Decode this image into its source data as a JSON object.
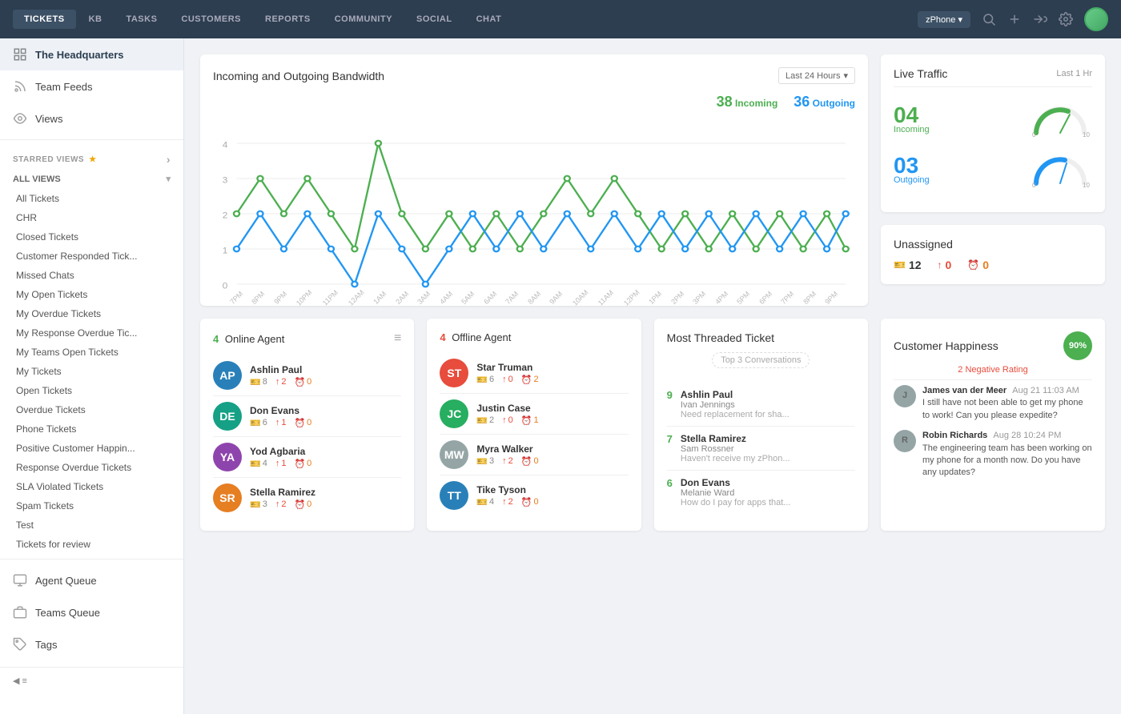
{
  "nav": {
    "tabs": [
      {
        "label": "TICKETS",
        "active": true
      },
      {
        "label": "KB",
        "active": false
      },
      {
        "label": "TASKS",
        "active": false
      },
      {
        "label": "CUSTOMERS",
        "active": false
      },
      {
        "label": "REPORTS",
        "active": false
      },
      {
        "label": "COMMUNITY",
        "active": false
      },
      {
        "label": "SOCIAL",
        "active": false
      },
      {
        "label": "CHAT",
        "active": false
      }
    ],
    "phone": "zPhone",
    "phone_arrow": "▾"
  },
  "sidebar": {
    "headquarters": "The Headquarters",
    "team_feeds": "Team Feeds",
    "views": "Views",
    "starred_label": "STARRED VIEWS",
    "all_views_label": "ALL VIEWS",
    "view_items": [
      "All Tickets",
      "CHR",
      "Closed Tickets",
      "Customer Responded Tick...",
      "Missed Chats",
      "My Open Tickets",
      "My Overdue Tickets",
      "My Response Overdue Tic...",
      "My Teams Open Tickets",
      "My Tickets",
      "Open Tickets",
      "Overdue Tickets",
      "Phone Tickets",
      "Positive Customer Happin...",
      "Response Overdue Tickets",
      "SLA Violated Tickets",
      "Spam Tickets",
      "Test",
      "Tickets for review"
    ],
    "agent_queue": "Agent Queue",
    "teams_queue": "Teams Queue",
    "tags": "Tags"
  },
  "bandwidth": {
    "title": "Incoming and Outgoing Bandwidth",
    "time_filter": "Last 24 Hours",
    "incoming_count": "38",
    "incoming_label": "Incoming",
    "outgoing_count": "36",
    "outgoing_label": "Outgoing",
    "y_labels": [
      "0",
      "1",
      "2",
      "3",
      "4"
    ],
    "x_labels": [
      "7PM",
      "8PM",
      "9PM",
      "10PM",
      "11PM",
      "12AM",
      "1AM",
      "2AM",
      "3AM",
      "4AM",
      "5AM",
      "6AM",
      "7AM",
      "8AM",
      "9AM",
      "10AM",
      "11AM",
      "12PM",
      "1PM",
      "2PM",
      "3PM",
      "4PM",
      "5PM",
      "6PM",
      "7PM",
      "8PM",
      "9PM"
    ]
  },
  "live_traffic": {
    "title": "Live Traffic",
    "time": "Last 1 Hr",
    "incoming_num": "04",
    "incoming_label": "Incoming",
    "outgoing_num": "03",
    "outgoing_label": "Outgoing"
  },
  "unassigned": {
    "title": "Unassigned",
    "ticket_count": "12",
    "urgent_count": "0",
    "overdue_count": "0"
  },
  "online_agents": {
    "count": "4",
    "title": "Online Agent",
    "agents": [
      {
        "name": "Ashlin Paul",
        "tickets": "8",
        "urgent": "2",
        "overdue": "0",
        "initials": "AP",
        "color": "av-blue"
      },
      {
        "name": "Don Evans",
        "tickets": "6",
        "urgent": "1",
        "overdue": "0",
        "initials": "DE",
        "color": "av-teal"
      },
      {
        "name": "Yod Agbaria",
        "tickets": "4",
        "urgent": "1",
        "overdue": "0",
        "initials": "YA",
        "color": "av-purple"
      },
      {
        "name": "Stella Ramirez",
        "tickets": "3",
        "urgent": "2",
        "overdue": "0",
        "initials": "SR",
        "color": "av-orange"
      }
    ]
  },
  "offline_agents": {
    "count": "4",
    "title": "Offline Agent",
    "agents": [
      {
        "name": "Star Truman",
        "tickets": "6",
        "urgent": "0",
        "overdue": "2",
        "initials": "ST",
        "color": "av-red"
      },
      {
        "name": "Justin Case",
        "tickets": "2",
        "urgent": "0",
        "overdue": "1",
        "initials": "JC",
        "color": "av-green"
      },
      {
        "name": "Myra Walker",
        "tickets": "3",
        "urgent": "2",
        "overdue": "0",
        "initials": "MW",
        "color": "av-gray"
      },
      {
        "name": "Tike Tyson",
        "tickets": "4",
        "urgent": "2",
        "overdue": "0",
        "initials": "TT",
        "color": "av-blue"
      }
    ]
  },
  "most_threaded": {
    "title": "Most Threaded Ticket",
    "top_conv_label": "Top 3 Conversations",
    "items": [
      {
        "count": "9",
        "name": "Ashlin Paul",
        "sub": "Ivan Jennings",
        "preview": "Need replacement for sha..."
      },
      {
        "count": "7",
        "name": "Stella Ramirez",
        "sub": "Sam Rossner",
        "preview": "Haven't receive my zPhon..."
      },
      {
        "count": "6",
        "name": "Don Evans",
        "sub": "Melanie Ward",
        "preview": "How do I pay for apps that..."
      }
    ]
  },
  "customer_happiness": {
    "title": "Customer Happiness",
    "percent": "90%",
    "negative_label": "2 Negative Rating",
    "feedbacks": [
      {
        "initial": "J",
        "color": "av-gray",
        "name": "James van der Meer",
        "date": "Aug 21 11:03 AM",
        "message": "I still have not been able to get my phone to work! Can you please expedite?"
      },
      {
        "initial": "R",
        "color": "av-gray",
        "name": "Robin Richards",
        "date": "Aug 28 10:24 PM",
        "message": "The engineering team has been working on my phone for a month now. Do you have any updates?"
      }
    ]
  }
}
